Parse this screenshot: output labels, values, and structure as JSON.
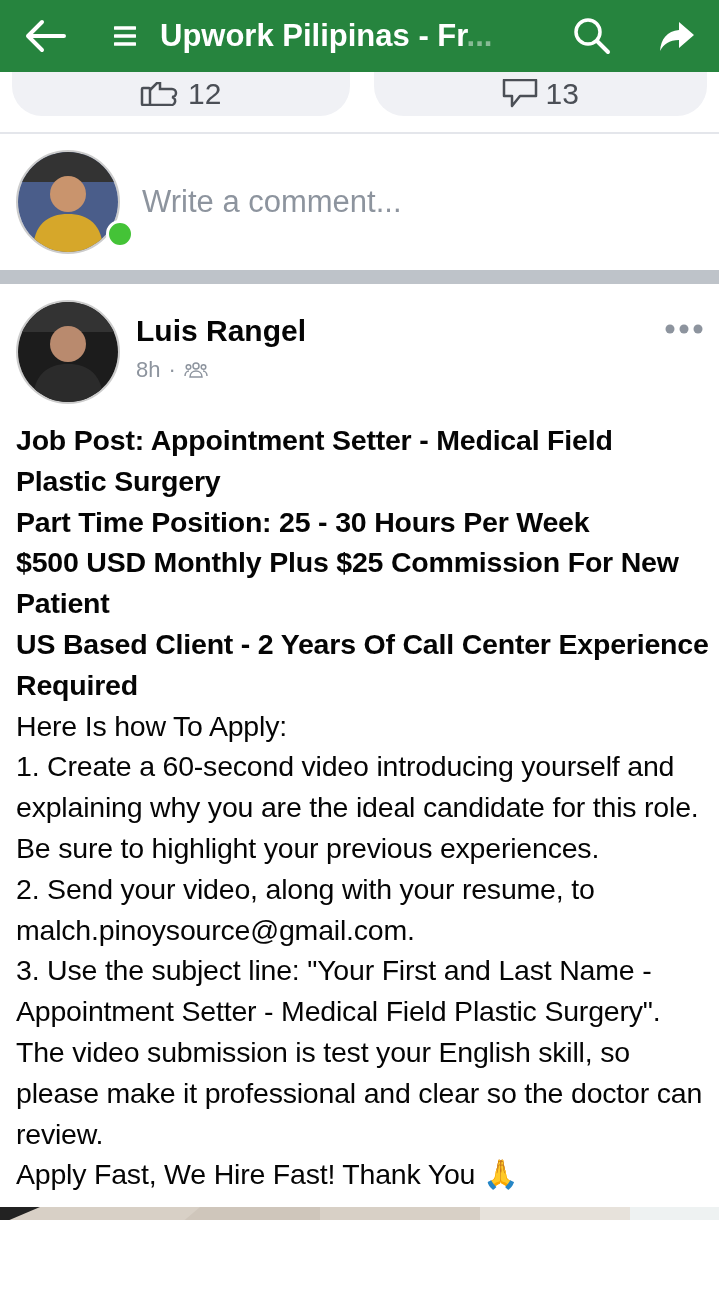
{
  "header": {
    "title": "Upwork Pilipinas - Fr",
    "ellipsis": "..."
  },
  "reactions": [
    {
      "kind": "like",
      "count": "12"
    },
    {
      "kind": "comment",
      "count": "13"
    }
  ],
  "comment_box": {
    "placeholder": "Write a comment...",
    "online": true
  },
  "post": {
    "author": "Luis Rangel",
    "time": "8h",
    "separator": "·",
    "lines": [
      {
        "text": "Job Post: Appointment Setter - Medical Field Plastic Surgery",
        "bold": true
      },
      {
        "text": "Part Time Position: 25 - 30 Hours Per Week",
        "bold": true
      },
      {
        "text": "$500 USD Monthly Plus $25 Commission For New Patient",
        "bold": true
      },
      {
        "text": "US Based Client - 2 Years Of Call Center Experience Required",
        "bold": true
      },
      {
        "text": "Here Is how To Apply:",
        "bold": false
      },
      {
        "text": "1. Create a 60-second video introducing yourself and explaining why you are the ideal candidate for this role. Be sure to highlight your previous experiences.",
        "bold": false
      },
      {
        "text": "2. Send your video, along with your resume, to malch.pinoysource@gmail.com.",
        "bold": false
      },
      {
        "text": "3. Use the subject line: \"Your First and Last Name - Appointment Setter - Medical Field Plastic Surgery\".",
        "bold": false
      },
      {
        "text": "The video submission is test your English skill, so please make it professional and clear so the doctor can review.",
        "bold": false
      },
      {
        "text": "Apply Fast, We Hire Fast! Thank You 🙏",
        "bold": false
      }
    ]
  }
}
